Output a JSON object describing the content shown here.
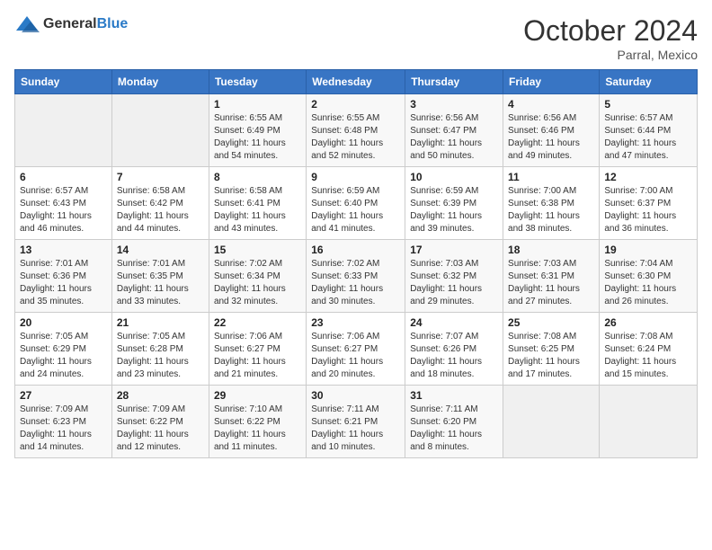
{
  "header": {
    "logo_general": "General",
    "logo_blue": "Blue",
    "month_title": "October 2024",
    "subtitle": "Parral, Mexico"
  },
  "days_of_week": [
    "Sunday",
    "Monday",
    "Tuesday",
    "Wednesday",
    "Thursday",
    "Friday",
    "Saturday"
  ],
  "weeks": [
    [
      {
        "day": "",
        "info": ""
      },
      {
        "day": "",
        "info": ""
      },
      {
        "day": "1",
        "info": "Sunrise: 6:55 AM\nSunset: 6:49 PM\nDaylight: 11 hours and 54 minutes."
      },
      {
        "day": "2",
        "info": "Sunrise: 6:55 AM\nSunset: 6:48 PM\nDaylight: 11 hours and 52 minutes."
      },
      {
        "day": "3",
        "info": "Sunrise: 6:56 AM\nSunset: 6:47 PM\nDaylight: 11 hours and 50 minutes."
      },
      {
        "day": "4",
        "info": "Sunrise: 6:56 AM\nSunset: 6:46 PM\nDaylight: 11 hours and 49 minutes."
      },
      {
        "day": "5",
        "info": "Sunrise: 6:57 AM\nSunset: 6:44 PM\nDaylight: 11 hours and 47 minutes."
      }
    ],
    [
      {
        "day": "6",
        "info": "Sunrise: 6:57 AM\nSunset: 6:43 PM\nDaylight: 11 hours and 46 minutes."
      },
      {
        "day": "7",
        "info": "Sunrise: 6:58 AM\nSunset: 6:42 PM\nDaylight: 11 hours and 44 minutes."
      },
      {
        "day": "8",
        "info": "Sunrise: 6:58 AM\nSunset: 6:41 PM\nDaylight: 11 hours and 43 minutes."
      },
      {
        "day": "9",
        "info": "Sunrise: 6:59 AM\nSunset: 6:40 PM\nDaylight: 11 hours and 41 minutes."
      },
      {
        "day": "10",
        "info": "Sunrise: 6:59 AM\nSunset: 6:39 PM\nDaylight: 11 hours and 39 minutes."
      },
      {
        "day": "11",
        "info": "Sunrise: 7:00 AM\nSunset: 6:38 PM\nDaylight: 11 hours and 38 minutes."
      },
      {
        "day": "12",
        "info": "Sunrise: 7:00 AM\nSunset: 6:37 PM\nDaylight: 11 hours and 36 minutes."
      }
    ],
    [
      {
        "day": "13",
        "info": "Sunrise: 7:01 AM\nSunset: 6:36 PM\nDaylight: 11 hours and 35 minutes."
      },
      {
        "day": "14",
        "info": "Sunrise: 7:01 AM\nSunset: 6:35 PM\nDaylight: 11 hours and 33 minutes."
      },
      {
        "day": "15",
        "info": "Sunrise: 7:02 AM\nSunset: 6:34 PM\nDaylight: 11 hours and 32 minutes."
      },
      {
        "day": "16",
        "info": "Sunrise: 7:02 AM\nSunset: 6:33 PM\nDaylight: 11 hours and 30 minutes."
      },
      {
        "day": "17",
        "info": "Sunrise: 7:03 AM\nSunset: 6:32 PM\nDaylight: 11 hours and 29 minutes."
      },
      {
        "day": "18",
        "info": "Sunrise: 7:03 AM\nSunset: 6:31 PM\nDaylight: 11 hours and 27 minutes."
      },
      {
        "day": "19",
        "info": "Sunrise: 7:04 AM\nSunset: 6:30 PM\nDaylight: 11 hours and 26 minutes."
      }
    ],
    [
      {
        "day": "20",
        "info": "Sunrise: 7:05 AM\nSunset: 6:29 PM\nDaylight: 11 hours and 24 minutes."
      },
      {
        "day": "21",
        "info": "Sunrise: 7:05 AM\nSunset: 6:28 PM\nDaylight: 11 hours and 23 minutes."
      },
      {
        "day": "22",
        "info": "Sunrise: 7:06 AM\nSunset: 6:27 PM\nDaylight: 11 hours and 21 minutes."
      },
      {
        "day": "23",
        "info": "Sunrise: 7:06 AM\nSunset: 6:27 PM\nDaylight: 11 hours and 20 minutes."
      },
      {
        "day": "24",
        "info": "Sunrise: 7:07 AM\nSunset: 6:26 PM\nDaylight: 11 hours and 18 minutes."
      },
      {
        "day": "25",
        "info": "Sunrise: 7:08 AM\nSunset: 6:25 PM\nDaylight: 11 hours and 17 minutes."
      },
      {
        "day": "26",
        "info": "Sunrise: 7:08 AM\nSunset: 6:24 PM\nDaylight: 11 hours and 15 minutes."
      }
    ],
    [
      {
        "day": "27",
        "info": "Sunrise: 7:09 AM\nSunset: 6:23 PM\nDaylight: 11 hours and 14 minutes."
      },
      {
        "day": "28",
        "info": "Sunrise: 7:09 AM\nSunset: 6:22 PM\nDaylight: 11 hours and 12 minutes."
      },
      {
        "day": "29",
        "info": "Sunrise: 7:10 AM\nSunset: 6:22 PM\nDaylight: 11 hours and 11 minutes."
      },
      {
        "day": "30",
        "info": "Sunrise: 7:11 AM\nSunset: 6:21 PM\nDaylight: 11 hours and 10 minutes."
      },
      {
        "day": "31",
        "info": "Sunrise: 7:11 AM\nSunset: 6:20 PM\nDaylight: 11 hours and 8 minutes."
      },
      {
        "day": "",
        "info": ""
      },
      {
        "day": "",
        "info": ""
      }
    ]
  ]
}
